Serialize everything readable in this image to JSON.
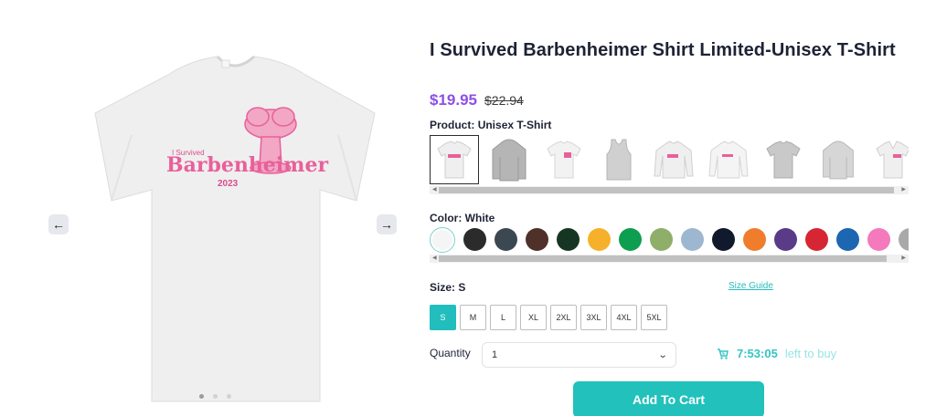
{
  "product": {
    "title": "I Survived Barbenheimer Shirt Limited-Unisex T-Shirt",
    "price": "$19.95",
    "old_price": "$22.94",
    "shirt_text": {
      "small": "I Survived",
      "big": "Barbenheimer",
      "year": "2023"
    }
  },
  "product_type": {
    "label": "Product:",
    "value": "Unisex T-Shirt",
    "items": [
      "Unisex T-Shirt",
      "Hoodie",
      "Youth T-Shirt",
      "Tank Top",
      "Sweatshirt",
      "Long Sleeve",
      "Kids T-Shirt",
      "Youth Hoodie",
      "V-Neck"
    ]
  },
  "color": {
    "label": "Color:",
    "value": "White",
    "swatches": [
      "#f5f5f5",
      "#2b2b2b",
      "#3b4852",
      "#503129",
      "#173523",
      "#f6b12a",
      "#0e9e4f",
      "#8fae6a",
      "#9db7d0",
      "#111a2c",
      "#f07d2b",
      "#5a3b88",
      "#d62634",
      "#1d66b1",
      "#f479bd",
      "#a9a9a9",
      "#cfcfcf"
    ]
  },
  "size": {
    "label": "Size:",
    "value": "S",
    "guide": "Size Guide",
    "options": [
      "S",
      "M",
      "L",
      "XL",
      "2XL",
      "3XL",
      "4XL",
      "5XL"
    ]
  },
  "quantity": {
    "label": "Quantity",
    "value": "1"
  },
  "timer": {
    "time": "7:53:05",
    "suffix": "left to buy"
  },
  "cart": {
    "label": "Add To Cart"
  },
  "colors": {
    "accent": "#22c1bb",
    "price": "#8e4fe6",
    "shirt_print": "#e8609a"
  },
  "icons": {
    "prev": "arrow-left-icon",
    "next": "arrow-right-icon",
    "timer": "cart-timer-icon",
    "select": "chevron-down-icon"
  }
}
